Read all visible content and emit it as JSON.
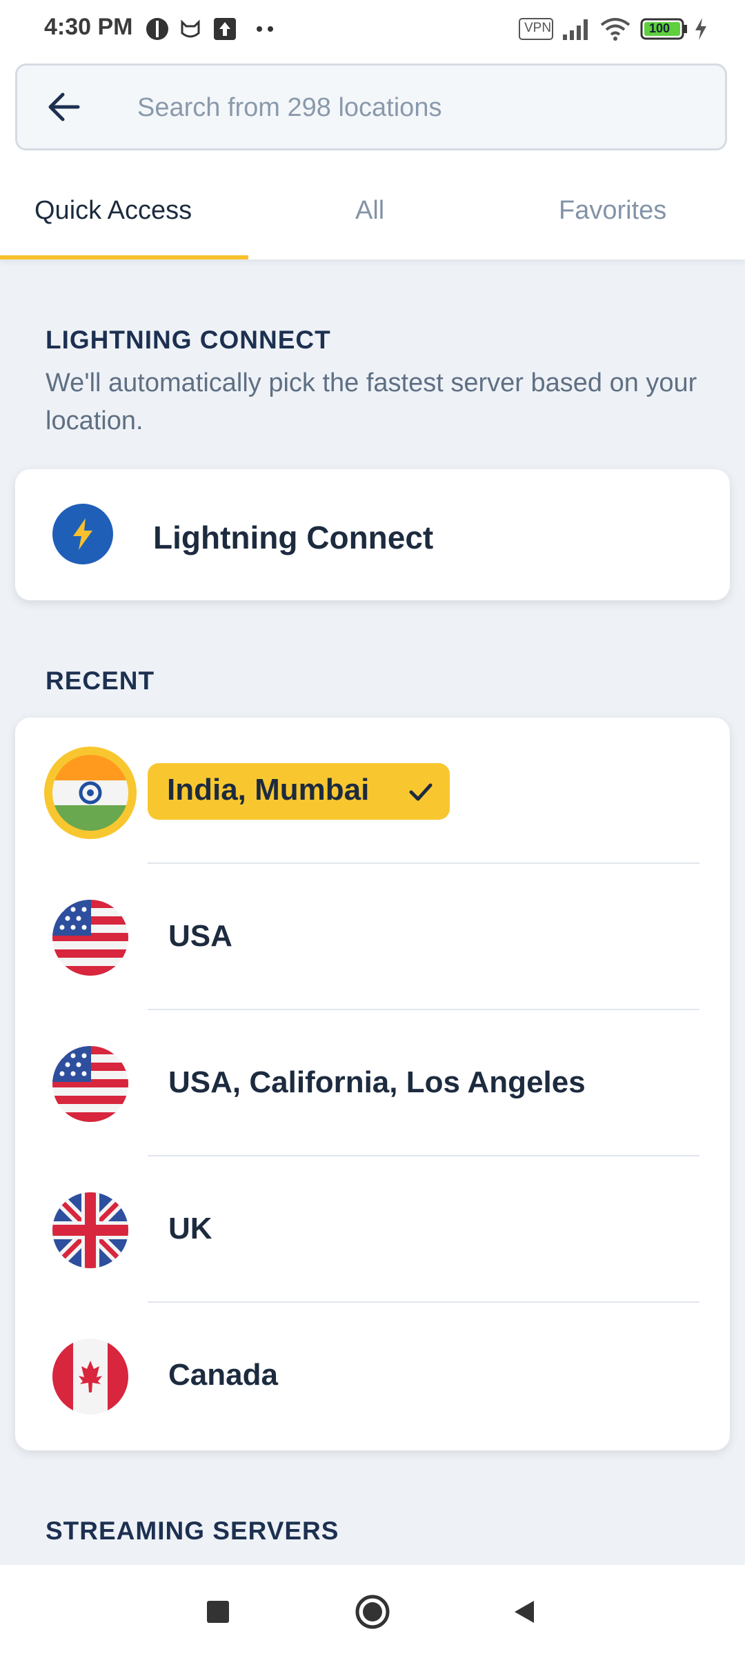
{
  "status_bar": {
    "time": "4:30 PM",
    "vpn_badge": "VPN",
    "battery": "100",
    "icons": [
      "notification-icon",
      "cat-icon",
      "upload-icon",
      "more-dots-icon",
      "vpn-icon",
      "signal-icon",
      "wifi-icon",
      "battery-icon",
      "charging-icon"
    ]
  },
  "search": {
    "placeholder": "Search from 298 locations"
  },
  "tabs": [
    {
      "label": "Quick Access",
      "active": true
    },
    {
      "label": "All",
      "active": false
    },
    {
      "label": "Favorites",
      "active": false
    }
  ],
  "lightning": {
    "heading": "LIGHTNING CONNECT",
    "description": "We'll automatically pick the fastest server based on your location.",
    "button_label": "Lightning Connect"
  },
  "recent": {
    "heading": "RECENT",
    "items": [
      {
        "label": "India, Mumbai",
        "flag": "india-flag-icon",
        "selected": true
      },
      {
        "label": "USA",
        "flag": "usa-flag-icon",
        "selected": false
      },
      {
        "label": "USA, California, Los Angeles",
        "flag": "usa-flag-icon",
        "selected": false
      },
      {
        "label": "UK",
        "flag": "uk-flag-icon",
        "selected": false
      },
      {
        "label": "Canada",
        "flag": "canada-flag-icon",
        "selected": false
      }
    ]
  },
  "streaming": {
    "heading": "STREAMING SERVERS"
  },
  "colors": {
    "accent": "#f8c72f",
    "primary_text": "#1d2b3f",
    "bolt_blue": "#1f5fb8"
  }
}
